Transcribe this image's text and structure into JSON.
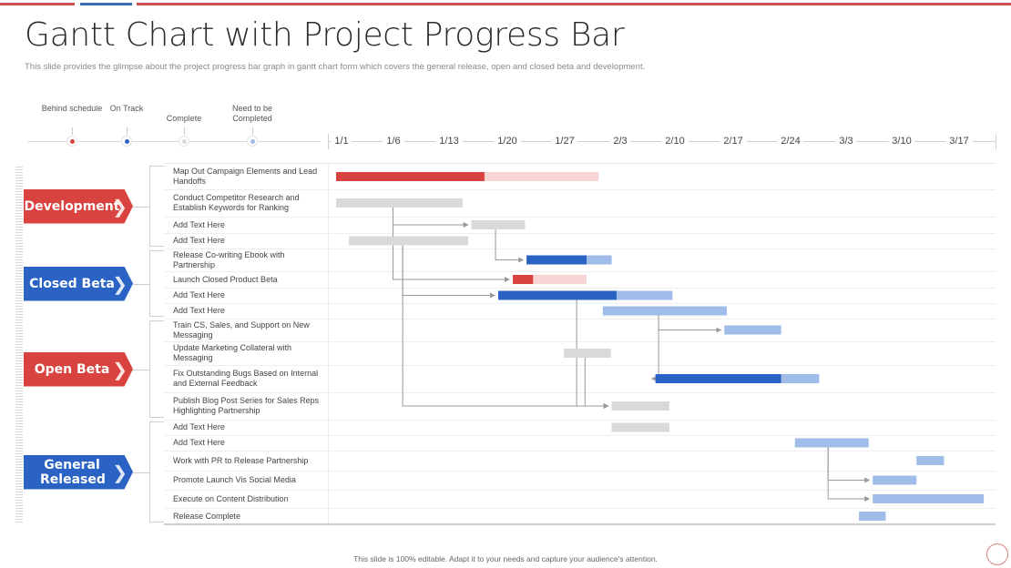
{
  "title": "Gantt Chart with Project Progress Bar",
  "subtitle": "This slide provides the glimpse about the project progress bar graph in gantt chart form which covers the general release, open and closed beta and development.",
  "footer": "This slide is 100% editable.  Adapt it to your needs and capture your audience's attention.",
  "colors": {
    "behind": "#d9433f",
    "behind_light": "#f8d5d5",
    "on_track": "#2a63c4",
    "on_track_light": "#a0bde9",
    "complete": "#d9d9d9",
    "need": "#a0bde9",
    "accent_red": "#c9524f",
    "accent_blue": "#3a6cb5"
  },
  "legend": [
    {
      "label": "Behind schedule",
      "key": "behind"
    },
    {
      "label": "On Track",
      "key": "on_track"
    },
    {
      "label": "Complete",
      "key": "complete"
    },
    {
      "label": "Need to be Completed",
      "key": "need"
    }
  ],
  "phases": [
    {
      "label": "Development",
      "color": "#d9433f"
    },
    {
      "label": "Closed Beta",
      "color": "#2a63c4"
    },
    {
      "label": "Open Beta",
      "color": "#d9433f"
    },
    {
      "label": "General Released",
      "color": "#2a63c4"
    }
  ],
  "chart_data": {
    "type": "gantt",
    "title": "Gantt Chart with Project Progress Bar",
    "x_unit": "days since 1/1",
    "xlim": [
      0,
      82
    ],
    "tick_labels": [
      "1/1",
      "1/6",
      "1/13",
      "1/20",
      "1/27",
      "2/3",
      "2/10",
      "2/17",
      "2/24",
      "3/3",
      "3/10",
      "3/17"
    ],
    "tick_days": [
      0.7,
      7,
      14,
      21,
      28,
      35,
      42,
      49,
      56,
      63,
      70,
      77
    ],
    "tasks": [
      {
        "phase": 0,
        "label": "Map Out Campaign Elements and Lead Handoffs",
        "start": 0,
        "end": 32.4,
        "done_until": 18.3,
        "status": "behind"
      },
      {
        "phase": 0,
        "label": "Conduct Competitor Research and Establish Keywords for Ranking",
        "start": 0,
        "end": 15.6,
        "done_until": 15.6,
        "status": "complete"
      },
      {
        "phase": 0,
        "label": "Add Text Here",
        "start": 16.7,
        "end": 23.3,
        "done_until": 23.3,
        "status": "complete"
      },
      {
        "phase": 0,
        "label": "Add Text Here",
        "start": 1.6,
        "end": 16.3,
        "done_until": 16.3,
        "status": "complete"
      },
      {
        "phase": 1,
        "label": "Release Co-writing Ebook with Partnership",
        "start": 23.5,
        "end": 34.0,
        "done_until": 30.9,
        "status": "on_track"
      },
      {
        "phase": 1,
        "label": "Launch Closed Product Beta",
        "start": 21.8,
        "end": 30.9,
        "done_until": 24.3,
        "status": "behind"
      },
      {
        "phase": 1,
        "label": "Add Text Here",
        "start": 20.0,
        "end": 41.5,
        "done_until": 34.6,
        "status": "on_track"
      },
      {
        "phase": 1,
        "label": "Add Text Here",
        "start": 32.9,
        "end": 48.2,
        "done_until": 32.9,
        "status": "need"
      },
      {
        "phase": 2,
        "label": "Train CS, Sales, and Support on New Messaging",
        "start": 47.9,
        "end": 54.9,
        "done_until": 47.9,
        "status": "need"
      },
      {
        "phase": 2,
        "label": "Update Marketing Collateral with Messaging",
        "start": 28.1,
        "end": 33.9,
        "done_until": 33.9,
        "status": "complete"
      },
      {
        "phase": 2,
        "label": "Fix Outstanding Bugs Based on Internal and External Feedback",
        "start": 39.4,
        "end": 59.6,
        "done_until": 54.9,
        "status": "on_track"
      },
      {
        "phase": 2,
        "label": "Publish Blog Post Series for Sales Reps Highlighting Partnership",
        "start": 34.0,
        "end": 41.1,
        "done_until": 41.1,
        "status": "complete"
      },
      {
        "phase": 3,
        "label": "Add Text Here",
        "start": 34.0,
        "end": 41.1,
        "done_until": 41.1,
        "status": "complete"
      },
      {
        "phase": 3,
        "label": "Add Text Here",
        "start": 56.6,
        "end": 65.7,
        "done_until": 56.6,
        "status": "need"
      },
      {
        "phase": 3,
        "label": "Work with PR to Release Partnership",
        "start": 71.6,
        "end": 75.0,
        "done_until": 71.6,
        "status": "need"
      },
      {
        "phase": 3,
        "label": "Promote Launch Vis Social Media",
        "start": 66.2,
        "end": 71.6,
        "done_until": 66.2,
        "status": "need"
      },
      {
        "phase": 3,
        "label": "Execute on Content Distribution",
        "start": 66.2,
        "end": 79.9,
        "done_until": 66.2,
        "status": "need"
      },
      {
        "phase": 3,
        "label": "Release Complete",
        "start": 64.5,
        "end": 67.8,
        "done_until": 64.5,
        "status": "need"
      }
    ],
    "dependencies": [
      {
        "from": 1,
        "to": 2
      },
      {
        "from": 1,
        "to": 5
      },
      {
        "from": 3,
        "to": 6
      },
      {
        "from": 3,
        "to": 11
      },
      {
        "from": 2,
        "to": 4
      },
      {
        "from": 6,
        "to": 11
      },
      {
        "from": 7,
        "to": 8
      },
      {
        "from": 7,
        "to": 10
      },
      {
        "from": 9,
        "to": 11
      },
      {
        "from": 13,
        "to": 15
      },
      {
        "from": 13,
        "to": 16
      }
    ]
  }
}
